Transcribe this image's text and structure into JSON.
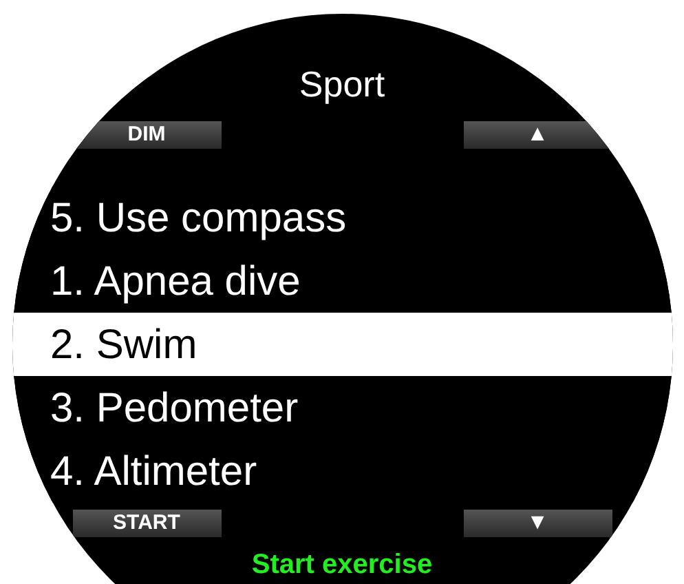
{
  "title": "Sport",
  "top_buttons": {
    "left": "DIM",
    "right": "▲"
  },
  "menu_items": [
    {
      "label": "5. Use compass",
      "selected": false
    },
    {
      "label": "1. Apnea dive",
      "selected": false
    },
    {
      "label": "2. Swim",
      "selected": true
    },
    {
      "label": "3. Pedometer",
      "selected": false
    },
    {
      "label": "4. Altimeter",
      "selected": false
    }
  ],
  "bottom_buttons": {
    "left": "START",
    "right": "▼"
  },
  "hint": "Start exercise"
}
